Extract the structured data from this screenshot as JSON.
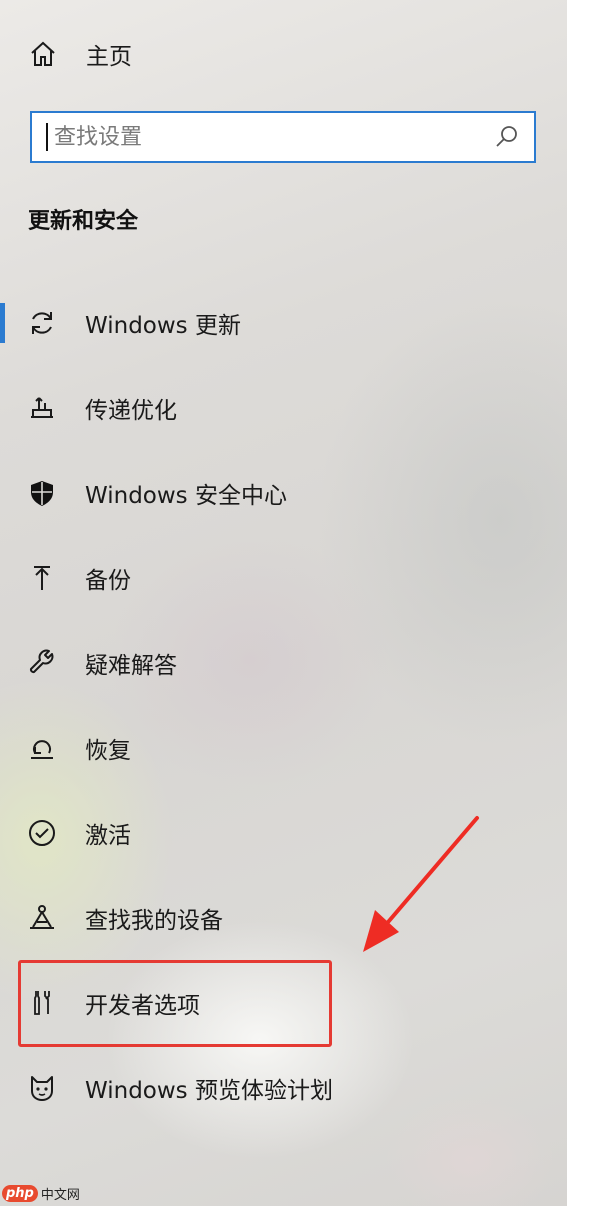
{
  "home": {
    "label": "主页",
    "icon": "home-icon"
  },
  "search": {
    "placeholder": "查找设置",
    "value": "",
    "icon": "search-icon"
  },
  "section": {
    "title": "更新和安全"
  },
  "nav": {
    "items": [
      {
        "label": "Windows 更新",
        "icon": "sync-icon",
        "selected": true
      },
      {
        "label": "传递优化",
        "icon": "delivery-optimization-icon"
      },
      {
        "label": "Windows 安全中心",
        "icon": "shield-icon"
      },
      {
        "label": "备份",
        "icon": "backup-arrow-icon"
      },
      {
        "label": "疑难解答",
        "icon": "wrench-icon"
      },
      {
        "label": "恢复",
        "icon": "recovery-icon"
      },
      {
        "label": "激活",
        "icon": "check-circle-icon"
      },
      {
        "label": "查找我的设备",
        "icon": "find-device-icon"
      },
      {
        "label": "开发者选项",
        "icon": "developer-tools-icon",
        "highlighted": true
      },
      {
        "label": "Windows 预览体验计划",
        "icon": "insider-cat-icon"
      }
    ]
  },
  "annotation": {
    "box_color": "#e53a33",
    "arrow_color": "#ee2c24"
  },
  "colors": {
    "accent": "#2b7bd0",
    "text": "#1a1a1a"
  },
  "watermark": {
    "logo": "php",
    "text": "中文网"
  }
}
